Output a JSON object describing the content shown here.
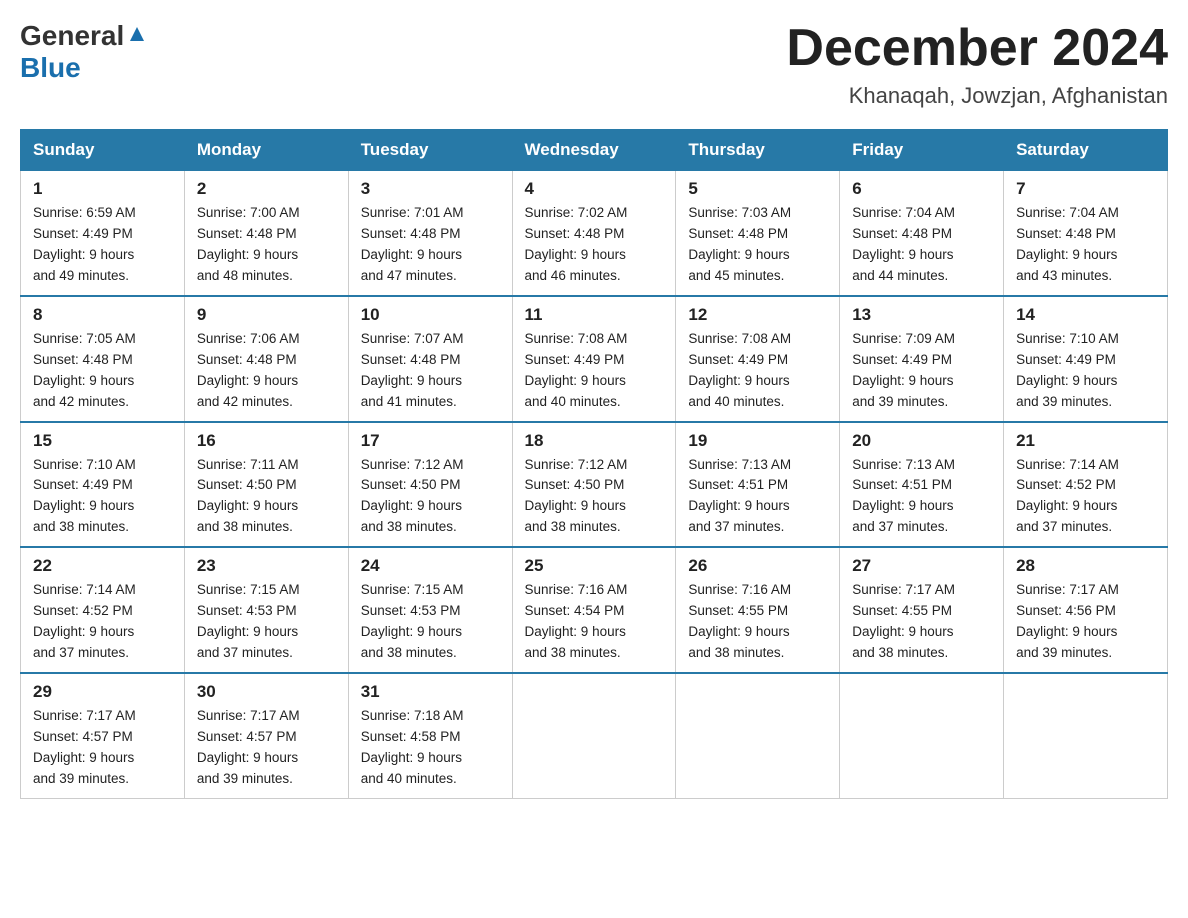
{
  "header": {
    "logo_general": "General",
    "logo_blue": "Blue",
    "month_title": "December 2024",
    "location": "Khanaqah, Jowzjan, Afghanistan"
  },
  "weekdays": [
    "Sunday",
    "Monday",
    "Tuesday",
    "Wednesday",
    "Thursday",
    "Friday",
    "Saturday"
  ],
  "weeks": [
    [
      {
        "day": "1",
        "sunrise": "6:59 AM",
        "sunset": "4:49 PM",
        "daylight": "9 hours and 49 minutes."
      },
      {
        "day": "2",
        "sunrise": "7:00 AM",
        "sunset": "4:48 PM",
        "daylight": "9 hours and 48 minutes."
      },
      {
        "day": "3",
        "sunrise": "7:01 AM",
        "sunset": "4:48 PM",
        "daylight": "9 hours and 47 minutes."
      },
      {
        "day": "4",
        "sunrise": "7:02 AM",
        "sunset": "4:48 PM",
        "daylight": "9 hours and 46 minutes."
      },
      {
        "day": "5",
        "sunrise": "7:03 AM",
        "sunset": "4:48 PM",
        "daylight": "9 hours and 45 minutes."
      },
      {
        "day": "6",
        "sunrise": "7:04 AM",
        "sunset": "4:48 PM",
        "daylight": "9 hours and 44 minutes."
      },
      {
        "day": "7",
        "sunrise": "7:04 AM",
        "sunset": "4:48 PM",
        "daylight": "9 hours and 43 minutes."
      }
    ],
    [
      {
        "day": "8",
        "sunrise": "7:05 AM",
        "sunset": "4:48 PM",
        "daylight": "9 hours and 42 minutes."
      },
      {
        "day": "9",
        "sunrise": "7:06 AM",
        "sunset": "4:48 PM",
        "daylight": "9 hours and 42 minutes."
      },
      {
        "day": "10",
        "sunrise": "7:07 AM",
        "sunset": "4:48 PM",
        "daylight": "9 hours and 41 minutes."
      },
      {
        "day": "11",
        "sunrise": "7:08 AM",
        "sunset": "4:49 PM",
        "daylight": "9 hours and 40 minutes."
      },
      {
        "day": "12",
        "sunrise": "7:08 AM",
        "sunset": "4:49 PM",
        "daylight": "9 hours and 40 minutes."
      },
      {
        "day": "13",
        "sunrise": "7:09 AM",
        "sunset": "4:49 PM",
        "daylight": "9 hours and 39 minutes."
      },
      {
        "day": "14",
        "sunrise": "7:10 AM",
        "sunset": "4:49 PM",
        "daylight": "9 hours and 39 minutes."
      }
    ],
    [
      {
        "day": "15",
        "sunrise": "7:10 AM",
        "sunset": "4:49 PM",
        "daylight": "9 hours and 38 minutes."
      },
      {
        "day": "16",
        "sunrise": "7:11 AM",
        "sunset": "4:50 PM",
        "daylight": "9 hours and 38 minutes."
      },
      {
        "day": "17",
        "sunrise": "7:12 AM",
        "sunset": "4:50 PM",
        "daylight": "9 hours and 38 minutes."
      },
      {
        "day": "18",
        "sunrise": "7:12 AM",
        "sunset": "4:50 PM",
        "daylight": "9 hours and 38 minutes."
      },
      {
        "day": "19",
        "sunrise": "7:13 AM",
        "sunset": "4:51 PM",
        "daylight": "9 hours and 37 minutes."
      },
      {
        "day": "20",
        "sunrise": "7:13 AM",
        "sunset": "4:51 PM",
        "daylight": "9 hours and 37 minutes."
      },
      {
        "day": "21",
        "sunrise": "7:14 AM",
        "sunset": "4:52 PM",
        "daylight": "9 hours and 37 minutes."
      }
    ],
    [
      {
        "day": "22",
        "sunrise": "7:14 AM",
        "sunset": "4:52 PM",
        "daylight": "9 hours and 37 minutes."
      },
      {
        "day": "23",
        "sunrise": "7:15 AM",
        "sunset": "4:53 PM",
        "daylight": "9 hours and 37 minutes."
      },
      {
        "day": "24",
        "sunrise": "7:15 AM",
        "sunset": "4:53 PM",
        "daylight": "9 hours and 38 minutes."
      },
      {
        "day": "25",
        "sunrise": "7:16 AM",
        "sunset": "4:54 PM",
        "daylight": "9 hours and 38 minutes."
      },
      {
        "day": "26",
        "sunrise": "7:16 AM",
        "sunset": "4:55 PM",
        "daylight": "9 hours and 38 minutes."
      },
      {
        "day": "27",
        "sunrise": "7:17 AM",
        "sunset": "4:55 PM",
        "daylight": "9 hours and 38 minutes."
      },
      {
        "day": "28",
        "sunrise": "7:17 AM",
        "sunset": "4:56 PM",
        "daylight": "9 hours and 39 minutes."
      }
    ],
    [
      {
        "day": "29",
        "sunrise": "7:17 AM",
        "sunset": "4:57 PM",
        "daylight": "9 hours and 39 minutes."
      },
      {
        "day": "30",
        "sunrise": "7:17 AM",
        "sunset": "4:57 PM",
        "daylight": "9 hours and 39 minutes."
      },
      {
        "day": "31",
        "sunrise": "7:18 AM",
        "sunset": "4:58 PM",
        "daylight": "9 hours and 40 minutes."
      },
      null,
      null,
      null,
      null
    ]
  ],
  "labels": {
    "sunrise": "Sunrise:",
    "sunset": "Sunset:",
    "daylight": "Daylight:"
  }
}
